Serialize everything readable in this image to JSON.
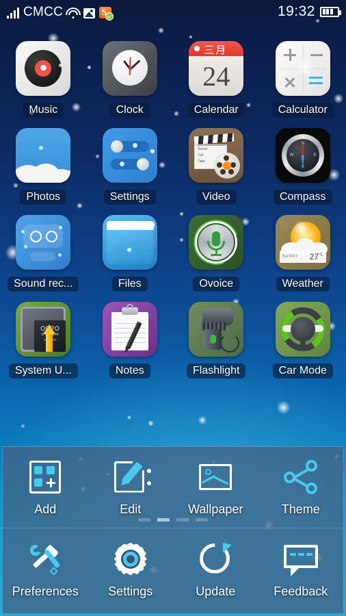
{
  "status_bar": {
    "carrier": "CMCC",
    "time": "19:32",
    "signal_icon": "signal-bars-icon",
    "wifi_icon": "wifi-icon",
    "screenshot_icon": "screenshot-icon",
    "ime_icon": "sogou-input-icon",
    "battery_icon": "battery-icon",
    "battery_level_bars": 3
  },
  "home": {
    "apps": [
      {
        "label": "Music",
        "icon": "music-icon"
      },
      {
        "label": "Clock",
        "icon": "clock-icon"
      },
      {
        "label": "Calendar",
        "icon": "calendar-icon",
        "month": "三月",
        "day": "24"
      },
      {
        "label": "Calculator",
        "icon": "calculator-icon"
      },
      {
        "label": "Photos",
        "icon": "photos-icon"
      },
      {
        "label": "Settings",
        "icon": "settings-icon"
      },
      {
        "label": "Video",
        "icon": "video-icon",
        "slate_lines": [
          "Scene",
          "Cut",
          "Take"
        ]
      },
      {
        "label": "Compass",
        "icon": "compass-icon",
        "directions": [
          "N",
          "E",
          "S",
          "W"
        ]
      },
      {
        "label": "Sound rec...",
        "icon": "sound-recorder-icon"
      },
      {
        "label": "Files",
        "icon": "files-icon"
      },
      {
        "label": "Ovoice",
        "icon": "ovoice-icon"
      },
      {
        "label": "Weather",
        "icon": "weather-icon",
        "condition": "SUNNY",
        "temperature": "27",
        "unit": "℃"
      },
      {
        "label": "System U...",
        "icon": "system-update-icon",
        "chip_brand": "OPPO",
        "chip_line2": "SYSTEM",
        "chip_line3": "MH9300"
      },
      {
        "label": "Notes",
        "icon": "notes-icon"
      },
      {
        "label": "Flashlight",
        "icon": "flashlight-icon"
      },
      {
        "label": "Car Mode",
        "icon": "car-mode-icon"
      }
    ]
  },
  "page_indicator": {
    "count": 4,
    "active_index": 1
  },
  "menu_panel": {
    "row1": [
      {
        "label": "Add",
        "icon": "add-widget-icon"
      },
      {
        "label": "Edit",
        "icon": "edit-icon"
      },
      {
        "label": "Wallpaper",
        "icon": "wallpaper-icon"
      },
      {
        "label": "Theme",
        "icon": "theme-share-icon"
      }
    ],
    "row2": [
      {
        "label": "Preferences",
        "icon": "tools-icon"
      },
      {
        "label": "Settings",
        "icon": "gear-icon"
      },
      {
        "label": "Update",
        "icon": "refresh-icon"
      },
      {
        "label": "Feedback",
        "icon": "speech-bubble-icon"
      }
    ]
  },
  "colors": {
    "accent_cyan": "#49c8f0",
    "panel_fill": "#465f82",
    "bg_top": "#0a1a3c",
    "bg_bottom": "#2aa7d2",
    "label_text": "#ffffff"
  }
}
